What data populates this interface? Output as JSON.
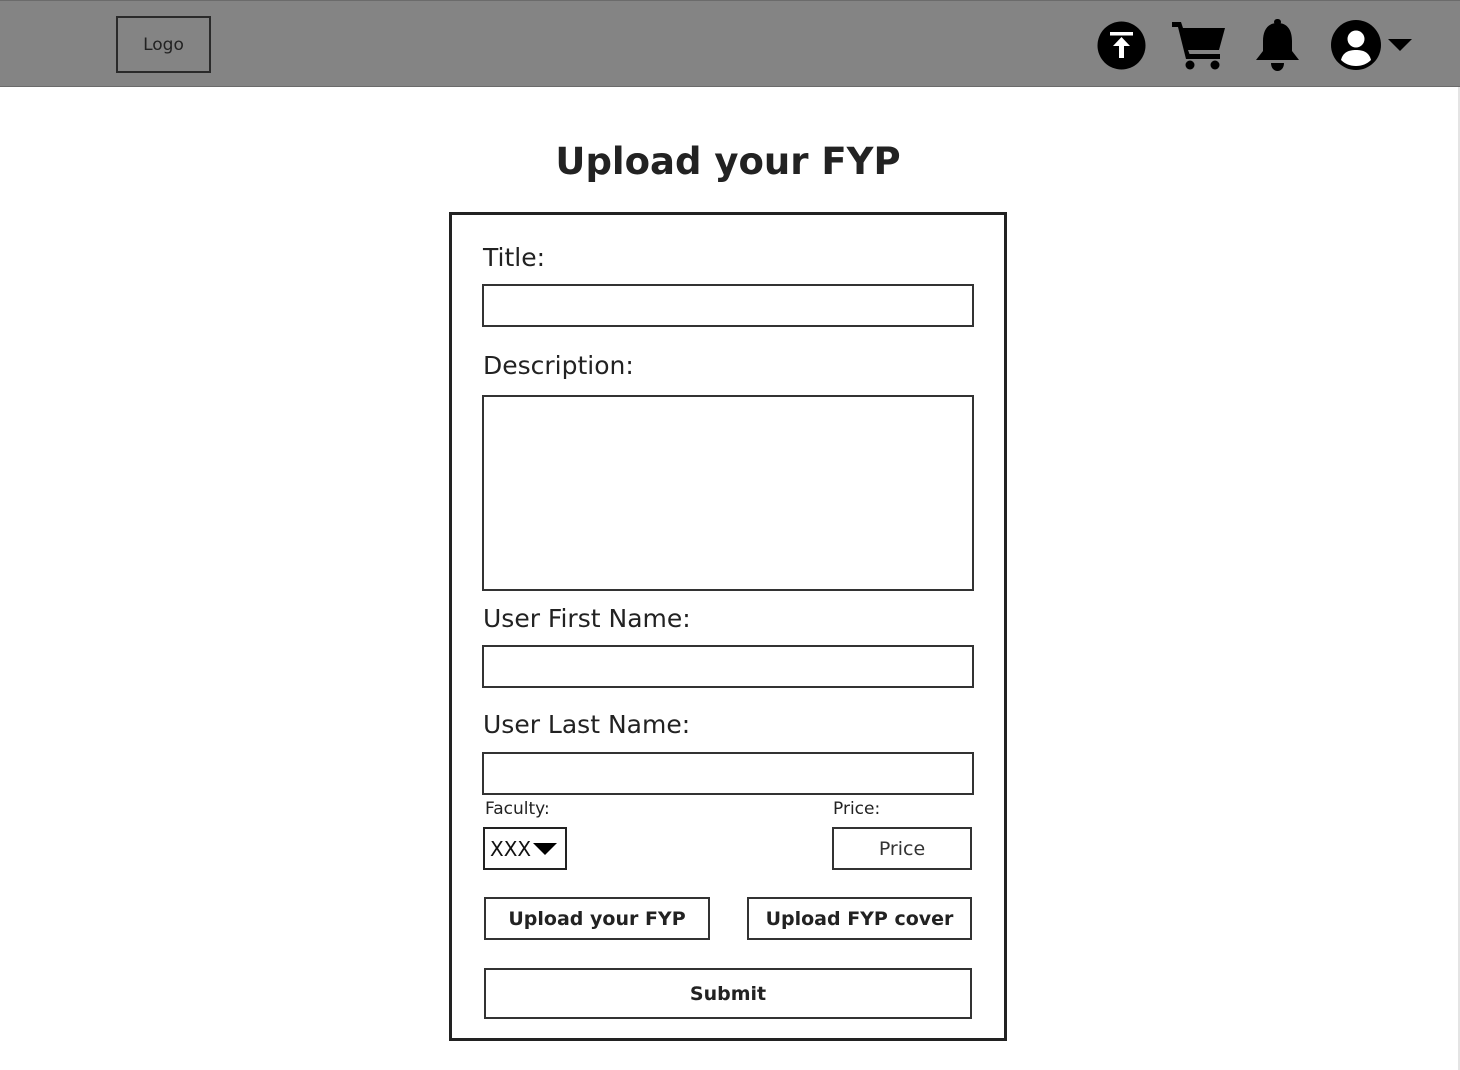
{
  "header": {
    "logo_label": "Logo",
    "icons": [
      "upload-icon",
      "cart-icon",
      "bell-icon",
      "user-icon",
      "caret-down-icon"
    ],
    "background_color": "#848484"
  },
  "page": {
    "title": "Upload your FYP"
  },
  "form": {
    "title_label": "Title:",
    "title_value": "",
    "description_label": "Description:",
    "description_value": "",
    "first_name_label": "User First Name:",
    "first_name_value": "",
    "last_name_label": "User Last Name:",
    "last_name_value": "",
    "faculty_label": "Faculty:",
    "faculty_selected": "XXX",
    "price_label": "Price:",
    "price_placeholder": "Price",
    "price_value": "",
    "upload_fyp_label": "Upload your FYP",
    "upload_cover_label": "Upload FYP cover",
    "submit_label": "Submit"
  }
}
